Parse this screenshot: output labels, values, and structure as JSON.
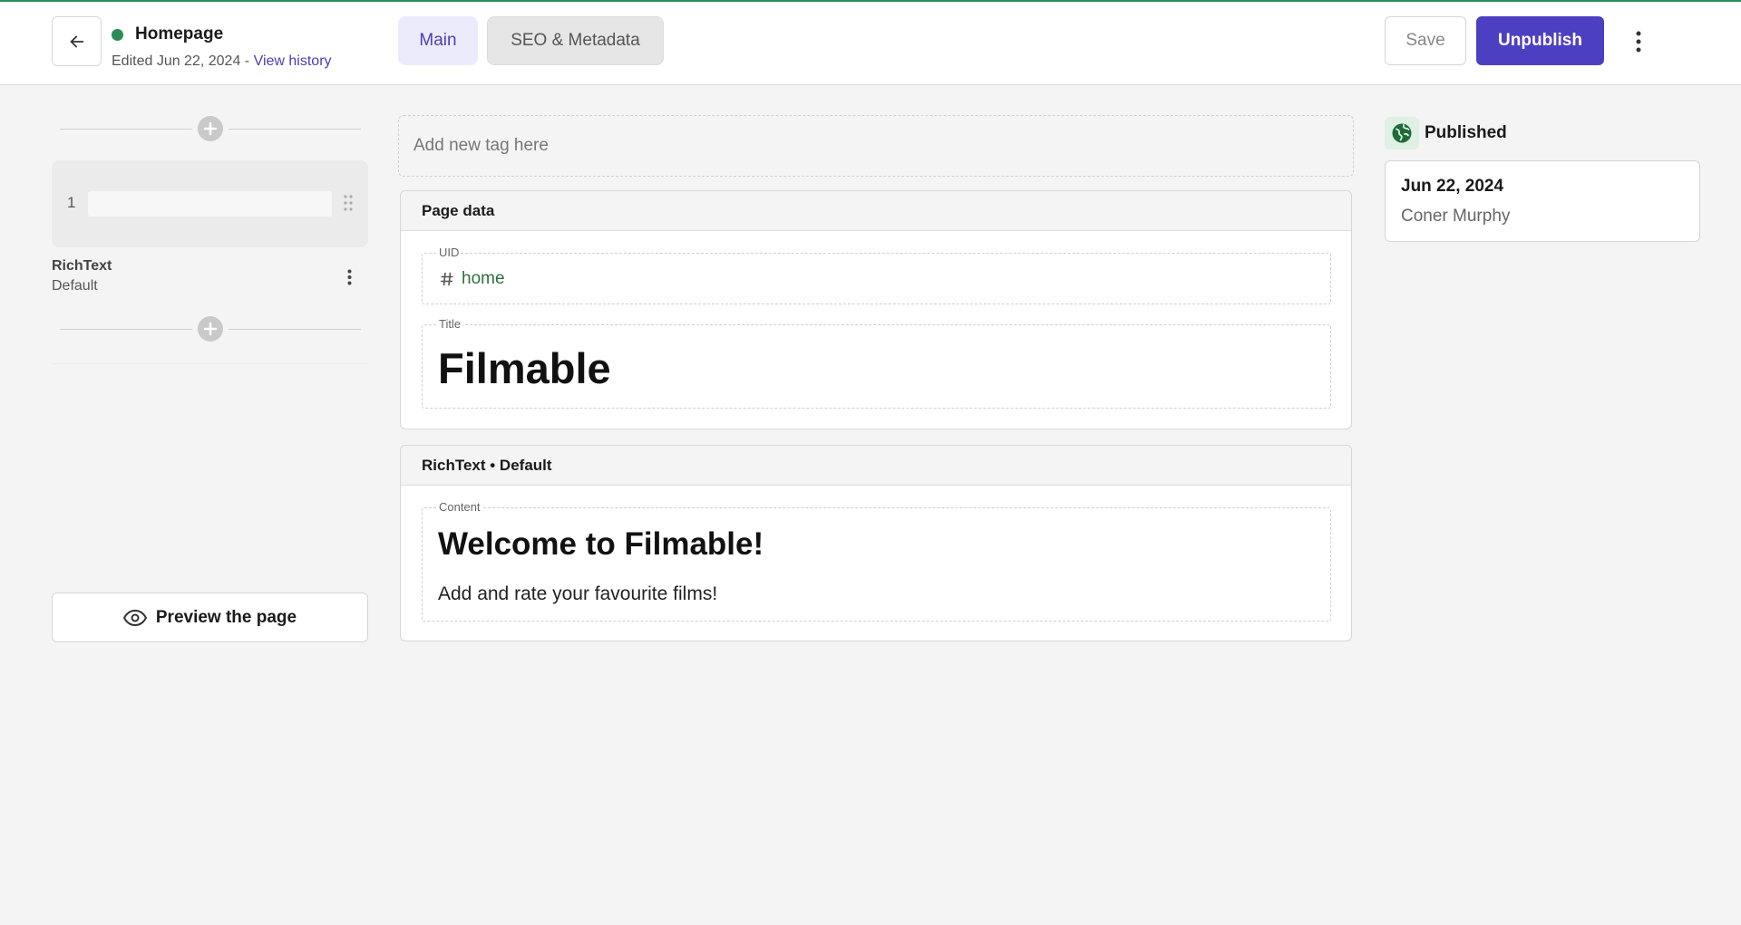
{
  "header": {
    "page_name": "Homepage",
    "edited_text": "Edited Jun 22, 2024 - ",
    "view_history": "View history",
    "tabs": [
      {
        "label": "Main",
        "active": true
      },
      {
        "label": "SEO & Metadata",
        "active": false
      }
    ],
    "save_label": "Save",
    "unpublish_label": "Unpublish"
  },
  "slices": {
    "items": [
      {
        "number": "1",
        "title": "RichText",
        "variation": "Default"
      }
    ]
  },
  "preview_label": "Preview the page",
  "tag_placeholder": "Add new tag here",
  "page_data": {
    "heading": "Page data",
    "uid_label": "UID",
    "uid_value": "home",
    "title_label": "Title",
    "title_value": "Filmable"
  },
  "richtext_panel": {
    "heading": "RichText • Default",
    "content_label": "Content",
    "content_heading": "Welcome to Filmable!",
    "content_paragraph": "Add and rate your favourite films!"
  },
  "publish": {
    "status": "Published",
    "date": "Jun 22, 2024",
    "user": "Coner Murphy"
  },
  "colors": {
    "accent": "#4d3fc2",
    "status_green": "#2e8b57",
    "tab_active_bg": "#ecebfb"
  }
}
